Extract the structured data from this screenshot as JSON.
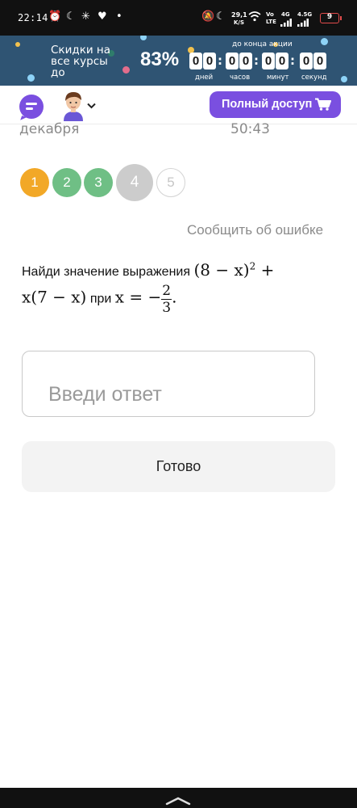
{
  "status_bar": {
    "time": "22:14",
    "net_speed_value": "29,1",
    "net_speed_unit": "K/S",
    "net_type_1_top": "Vo",
    "net_type_1_bottom": "LTE",
    "net_type_2": "4G",
    "net_type_3": "4.5G",
    "battery": "9",
    "icons": [
      "alarm-clock-icon",
      "moon-icon",
      "sparkle-icon",
      "heart-icon",
      "dot-icon",
      "mute-bell-icon",
      "moon-icon",
      "wifi-icon",
      "signal-icon",
      "battery-icon"
    ],
    "battery_color": "#e34c4c"
  },
  "promo": {
    "text": "Скидки на все курсы до",
    "percent": "83%",
    "until_label": "до конца акции",
    "countdown": [
      "0",
      "0",
      "0",
      "0",
      "0",
      "0",
      "0",
      "0"
    ],
    "units": [
      "дней",
      "часов",
      "минут",
      "секунд"
    ],
    "background": "#2f5473"
  },
  "header": {
    "full_access_label": "Полный доступ",
    "accent": "#7a4fe0",
    "icons": [
      "chat-icon",
      "avatar",
      "chevron-down-icon",
      "cart-icon"
    ]
  },
  "scrolled": {
    "left_text": "декабря",
    "right_text": "50:43"
  },
  "steps": [
    {
      "label": "1",
      "state": "current",
      "color": "#f2a827"
    },
    {
      "label": "2",
      "state": "done",
      "color": "#6fbf85"
    },
    {
      "label": "3",
      "state": "done",
      "color": "#6fbf85"
    },
    {
      "label": "4",
      "state": "selected",
      "color": "#cccccc"
    },
    {
      "label": "5",
      "state": "pending",
      "color": "#ffffff"
    }
  ],
  "report_link": "Сообщить об ошибке",
  "task": {
    "prefix": "Найди значение выражения",
    "expr_part1": "(8 − x)",
    "expr_exp": "2",
    "expr_plus": "+",
    "expr_part2": "x(7 − x)",
    "when": "при",
    "eq": "x = −",
    "frac_num": "2",
    "frac_den": "3",
    "end": "."
  },
  "answer": {
    "placeholder": "Введи ответ",
    "value": ""
  },
  "done_label": "Готово"
}
